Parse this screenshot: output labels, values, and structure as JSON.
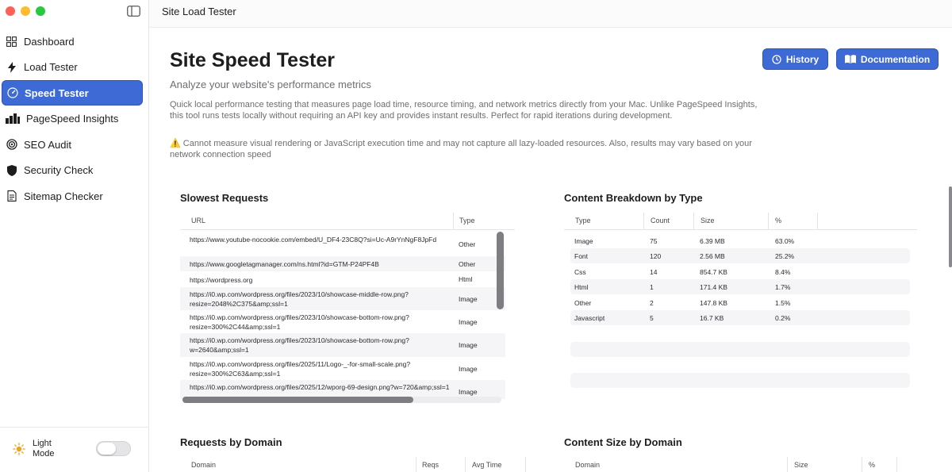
{
  "window": {
    "title": "Site Load Tester"
  },
  "sidebar": {
    "items": [
      {
        "label": "Dashboard",
        "icon": "grid-icon",
        "active": false
      },
      {
        "label": "Load Tester",
        "icon": "bolt-icon",
        "active": false
      },
      {
        "label": "Speed Tester",
        "icon": "gauge-icon",
        "active": true
      },
      {
        "label": "PageSpeed Insights",
        "icon": "bar-chart-icon",
        "active": false
      },
      {
        "label": "SEO Audit",
        "icon": "target-icon",
        "active": false
      },
      {
        "label": "Security Check",
        "icon": "shield-icon",
        "active": false
      },
      {
        "label": "Sitemap Checker",
        "icon": "document-icon",
        "active": false
      }
    ],
    "theme": {
      "label": "Light Mode",
      "enabled": false
    }
  },
  "header": {
    "title": "Site Speed Tester",
    "subtitle": "Analyze your website's performance metrics",
    "description": "Quick local performance testing that measures page load time, resource timing, and network metrics directly from your Mac. Unlike PageSpeed Insights, this tool runs tests locally without requiring an API key and provides instant results. Perfect for rapid iterations during development.",
    "warning": "⚠️ Cannot measure visual rendering or JavaScript execution time and may not capture all lazy-loaded resources. Also, results may vary based on your network connection speed",
    "history_label": "History",
    "docs_label": "Documentation"
  },
  "slowest_requests": {
    "title": "Slowest Requests",
    "columns": [
      "URL",
      "Type"
    ],
    "rows": [
      {
        "url": "https://www.youtube-nocookie.com/embed/U_DF4-23C8Q?si=Uc-A9rYnNgF8JpFd",
        "type": "Other"
      },
      {
        "url": "https://www.googletagmanager.com/ns.html?id=GTM-P24PF4B",
        "type": "Other"
      },
      {
        "url": "https://wordpress.org",
        "type": "Html"
      },
      {
        "url": "https://i0.wp.com/wordpress.org/files/2023/10/showcase-middle-row.png?resize=2048%2C375&amp;ssl=1",
        "type": "Image"
      },
      {
        "url": "https://i0.wp.com/wordpress.org/files/2023/10/showcase-bottom-row.png?resize=300%2C44&amp;ssl=1",
        "type": "Image"
      },
      {
        "url": "https://i0.wp.com/wordpress.org/files/2023/10/showcase-bottom-row.png?w=2640&amp;ssl=1",
        "type": "Image"
      },
      {
        "url": "https://i0.wp.com/wordpress.org/files/2025/11/Logo-_-for-small-scale.png?resize=300%2C63&amp;ssl=1",
        "type": "Image"
      },
      {
        "url": "https://i0.wp.com/wordpress.org/files/2025/12/wporg-69-design.png?w=720&amp;ssl=1",
        "type": "Image"
      }
    ]
  },
  "content_breakdown": {
    "title": "Content Breakdown by Type",
    "columns": [
      "Type",
      "Count",
      "Size",
      "%"
    ],
    "rows": [
      {
        "type": "Image",
        "count": "75",
        "size": "6.39 MB",
        "pct": "63.0%"
      },
      {
        "type": "Font",
        "count": "120",
        "size": "2.56 MB",
        "pct": "25.2%"
      },
      {
        "type": "Css",
        "count": "14",
        "size": "854.7 KB",
        "pct": "8.4%"
      },
      {
        "type": "Html",
        "count": "1",
        "size": "171.4 KB",
        "pct": "1.7%"
      },
      {
        "type": "Other",
        "count": "2",
        "size": "147.8 KB",
        "pct": "1.5%"
      },
      {
        "type": "Javascript",
        "count": "5",
        "size": "16.7 KB",
        "pct": "0.2%"
      }
    ]
  },
  "requests_by_domain": {
    "title": "Requests by Domain",
    "columns": [
      "Domain",
      "Reqs",
      "Avg Time"
    ]
  },
  "content_size_by_domain": {
    "title": "Content Size by Domain",
    "columns": [
      "Domain",
      "Size",
      "%"
    ]
  },
  "colors": {
    "accent": "#3e6ad6",
    "muted_text": "#6e6e73",
    "row_alt": "#f5f5f7"
  }
}
